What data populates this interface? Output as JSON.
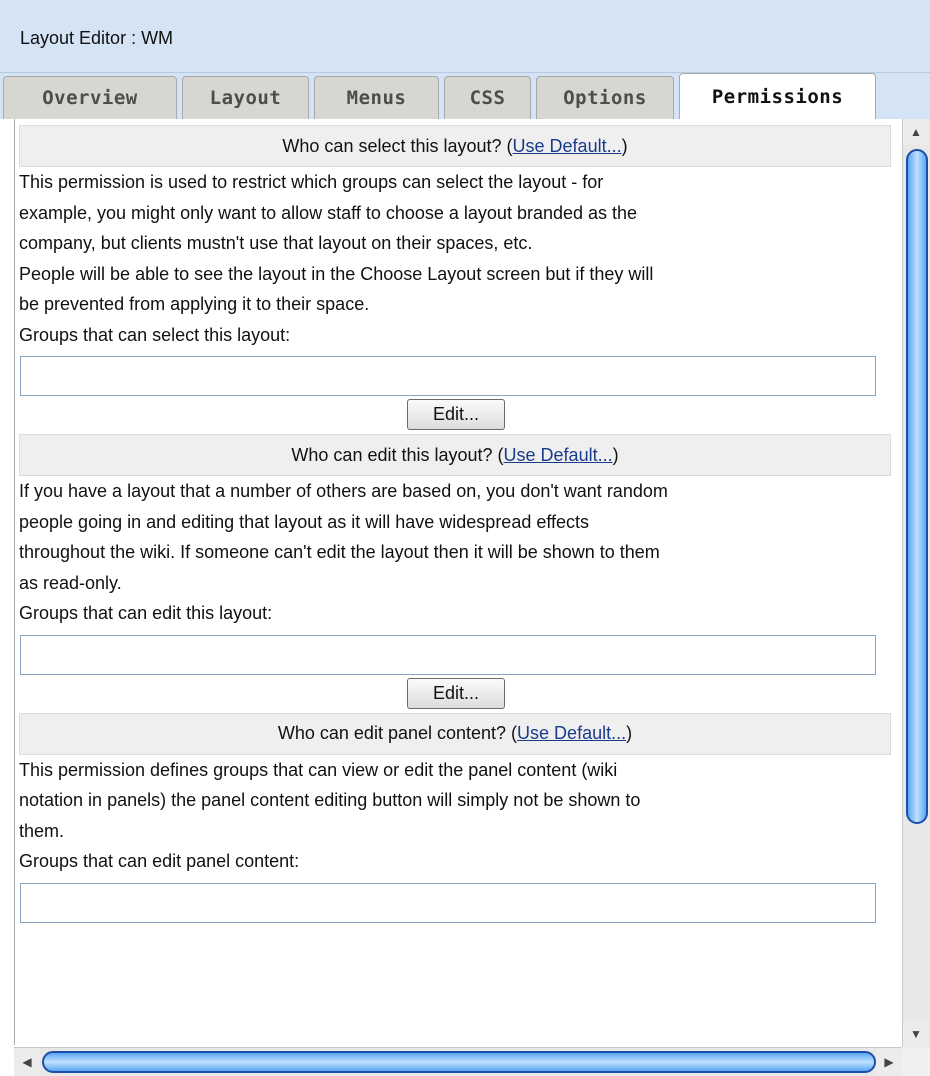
{
  "window": {
    "title": "Layout Editor : WM"
  },
  "tabs": [
    {
      "label": "Overview"
    },
    {
      "label": "Layout"
    },
    {
      "label": "Menus"
    },
    {
      "label": "CSS"
    },
    {
      "label": "Options"
    },
    {
      "label": "Permissions",
      "active": true
    }
  ],
  "sections": [
    {
      "header_prefix": "Who can select this layout? (",
      "header_link": "Use Default...",
      "header_suffix": ")",
      "lines": [
        "This permission is used to restrict which groups can select the layout - for",
        "example, you might only want to allow staff to choose a layout branded as the",
        "company, but clients mustn't use that layout on their spaces, etc.",
        "People will be able to see the layout in the Choose Layout screen but if they will",
        "be prevented from applying it to their space."
      ],
      "field_label": "Groups that can select this layout:",
      "field_value": "",
      "button": "Edit..."
    },
    {
      "header_prefix": "Who can edit this layout? (",
      "header_link": "Use Default...",
      "header_suffix": ")",
      "lines": [
        "If you have a layout that a number of others are based on, you don't want random",
        "people going in and editing that layout as it will have widespread effects",
        "throughout the wiki. If someone can't edit the layout then it will be shown to them",
        "as read-only."
      ],
      "field_label": "Groups that can edit this layout:",
      "field_value": "",
      "button": "Edit..."
    },
    {
      "header_prefix": "Who can edit panel content? (",
      "header_link": "Use Default...",
      "header_suffix": ")",
      "lines": [
        "This permission defines groups that can view or edit the panel content (wiki",
        "notation in panels) the panel content editing button will simply not be shown to",
        "them."
      ],
      "field_label": "Groups that can edit panel content:",
      "field_value": ""
    }
  ],
  "scrollbars": {
    "vertical_position": 0,
    "horizontal_position": 0
  },
  "colors": {
    "titlebar": "#d4e4f5",
    "scroll_thumb": "#5aa6f2",
    "link": "#1a3b8a"
  }
}
